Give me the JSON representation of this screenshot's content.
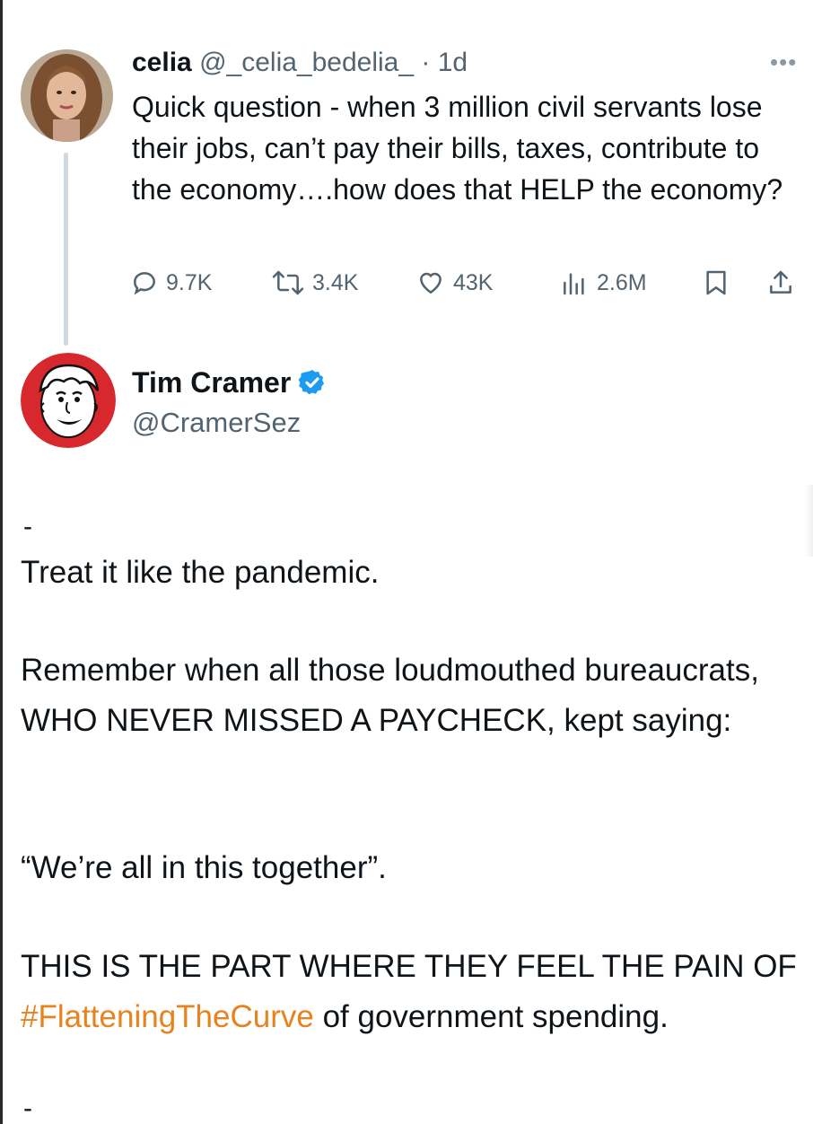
{
  "reply_to": {
    "name": "celia",
    "handle": "@_celia_bedelia_",
    "separator": " · ",
    "time": "1d",
    "more": "•••",
    "text": "Quick question - when 3 million civil servants lose their jobs, can’t pay their bills, taxes, contribute to the economy….how does that HELP the economy?",
    "stats": {
      "replies": "9.7K",
      "reposts": "3.4K",
      "likes": "43K",
      "views": "2.6M"
    }
  },
  "post": {
    "name": "Tim Cramer",
    "handle": "@CramerSez",
    "dash_top": "-",
    "p1": "Treat it like the pandemic.",
    "p2": "Remember when all those loudmouthed bureaucrats, WHO NEVER MISSED A PAYCHECK, kept saying:",
    "p3": "“We’re all in this together”.",
    "p4_before": "THIS IS THE PART WHERE THEY FEEL THE PAIN OF ",
    "p4_hashtag": "#FlatteningTheCurve",
    "p4_after": " of government spending.",
    "dash_bottom": "-"
  },
  "colors": {
    "text": "#0f1419",
    "muted": "#536471",
    "verified": "#1d9bf0",
    "hashtag": "#e8821e",
    "thread_line": "#cfd9de"
  },
  "icons": [
    "more-icon",
    "reply-icon",
    "repost-icon",
    "like-icon",
    "views-icon",
    "bookmark-icon",
    "share-icon",
    "verified-badge-icon"
  ]
}
